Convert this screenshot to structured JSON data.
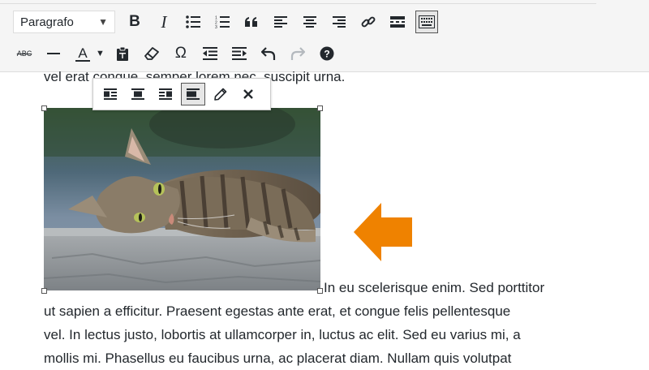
{
  "editor": {
    "format_select": "Paragrafo",
    "content_partial_top": "vel erat congue, semper lorem nec, suscipit urna.",
    "paragraph_lines": [
      "In eu scelerisque enim. Sed porttitor",
      "ut sapien a efficitur. Praesent egestas ante erat, et congue felis pellentesque",
      "vel. In lectus justo, lobortis at ullamcorper in, luctus ac elit. Sed eu varius mi, a",
      "mollis mi. Phasellus eu faucibus urna, ac placerat diam. Nullam quis volutpat"
    ]
  },
  "toolbar_row1": [
    "bold-icon",
    "italic-icon",
    "bullet-list-icon",
    "numbered-list-icon",
    "blockquote-icon",
    "align-left-icon",
    "align-center-icon",
    "align-right-icon",
    "link-icon",
    "read-more-icon",
    "toolbar-toggle-icon"
  ],
  "toolbar_row2": [
    "strikethrough-icon",
    "horizontal-line-icon",
    "text-color-icon",
    "paste-as-text-icon",
    "clear-formatting-icon",
    "special-character-icon",
    "outdent-icon",
    "indent-icon",
    "undo-icon",
    "redo-icon",
    "help-icon"
  ],
  "image_toolbar": [
    "align-left-icon",
    "align-center-icon",
    "align-right-icon",
    "no-alignment-icon",
    "edit-icon",
    "remove-icon"
  ],
  "labels": {
    "bold": "B",
    "italic": "I",
    "strikethrough": "ABC",
    "text_color": "A",
    "special_character": "Ω"
  },
  "colors": {
    "accent_arrow": "#ef8200",
    "text": "#23282d",
    "toolbar_bg": "#f5f5f5"
  }
}
